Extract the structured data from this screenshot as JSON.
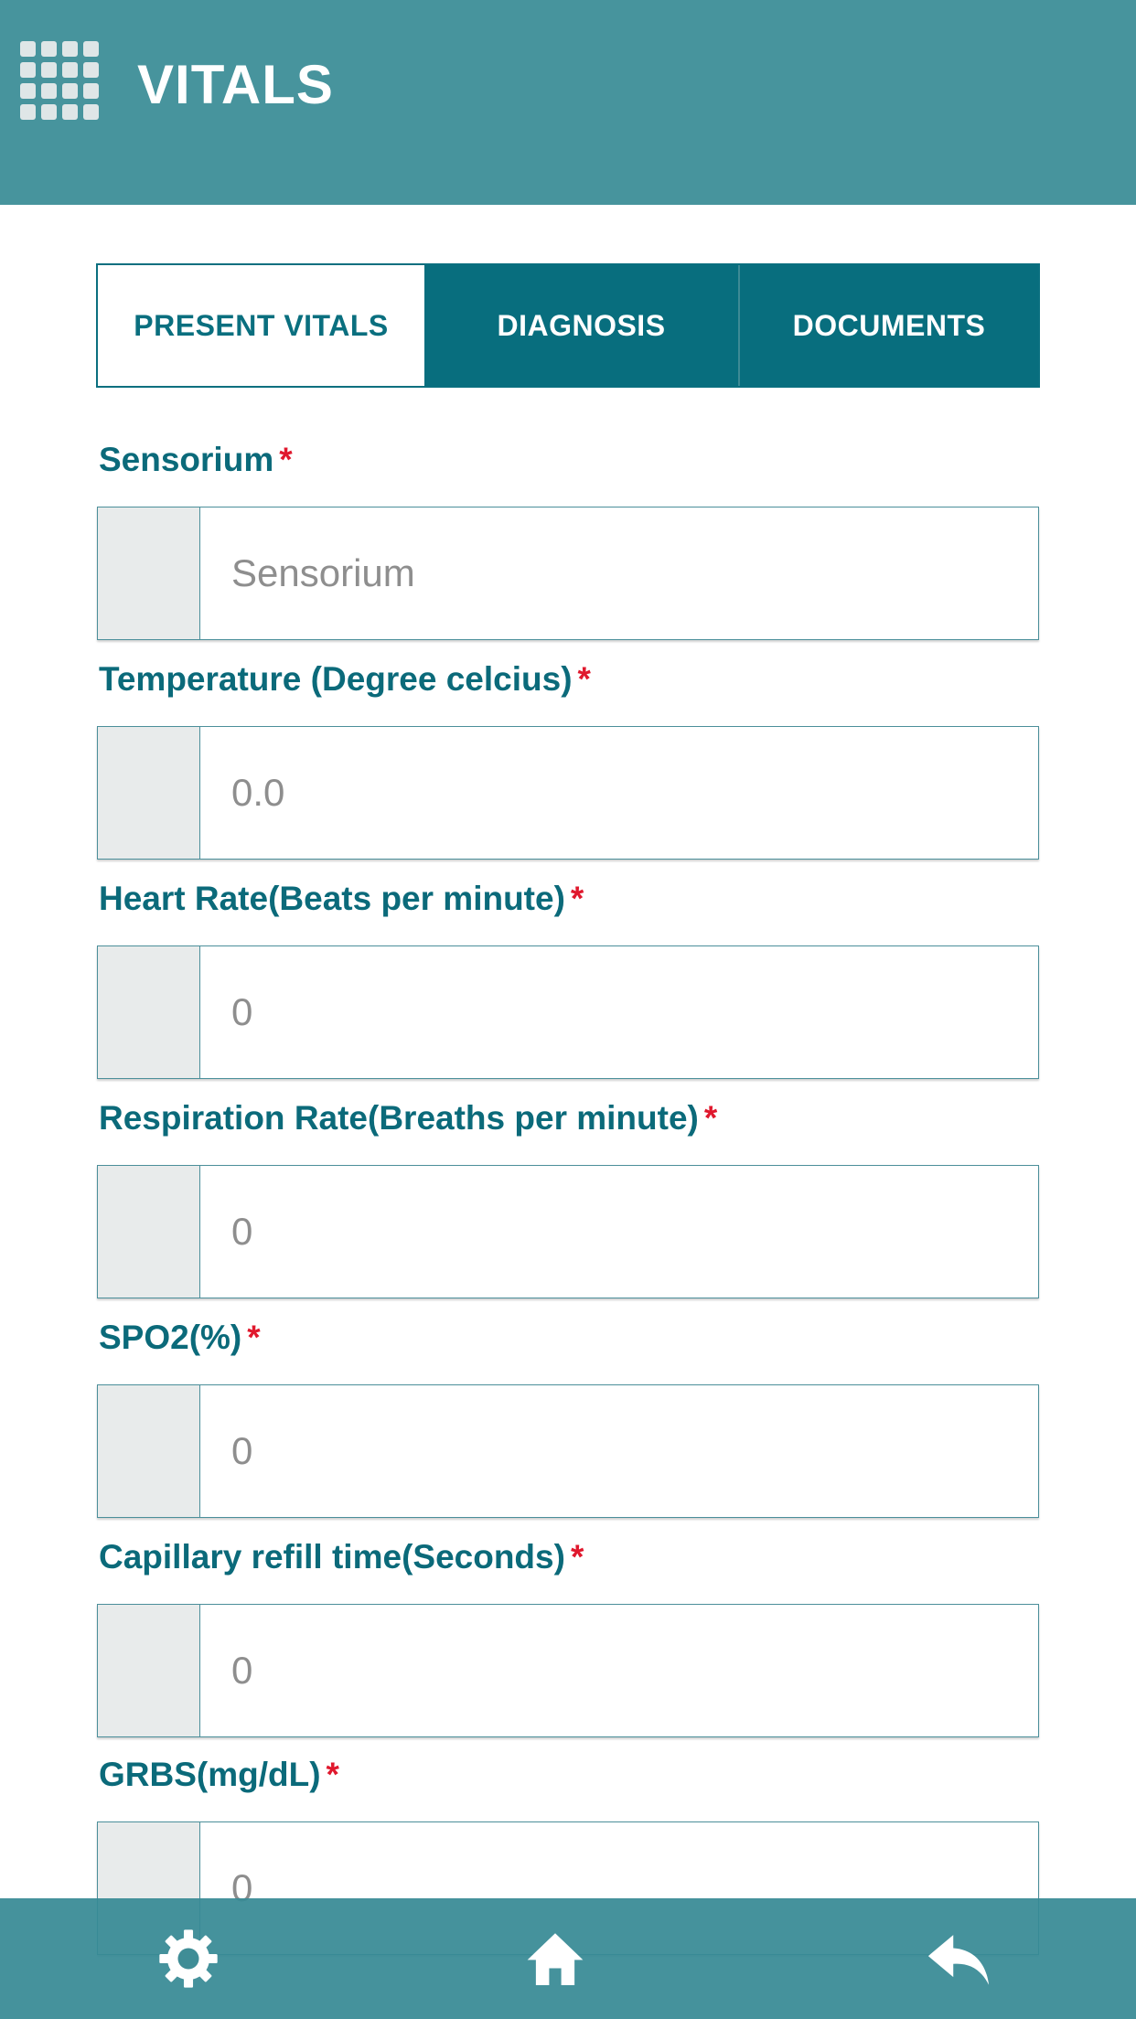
{
  "header": {
    "title": "VITALS",
    "menu_icon": "grid-menu-icon"
  },
  "tabs": [
    {
      "label": "PRESENT VITALS",
      "active": true
    },
    {
      "label": "DIAGNOSIS",
      "active": false
    },
    {
      "label": "DOCUMENTS",
      "active": false
    }
  ],
  "fields": [
    {
      "label": "Sensorium",
      "required": "*",
      "placeholder": "Sensorium"
    },
    {
      "label": "Temperature (Degree celcius)",
      "required": "*",
      "placeholder": "0.0"
    },
    {
      "label": "Heart Rate(Beats per minute)",
      "required": "*",
      "placeholder": "0"
    },
    {
      "label": "Respiration Rate(Breaths per minute)",
      "required": "*",
      "placeholder": "0"
    },
    {
      "label": "SPO2(%)",
      "required": "*",
      "placeholder": "0"
    },
    {
      "label": "Capillary refill time(Seconds)",
      "required": "*",
      "placeholder": "0"
    },
    {
      "label": "GRBS(mg/dL)",
      "required": "*",
      "placeholder": "0"
    }
  ],
  "footer": {
    "icons": [
      "settings-icon",
      "home-icon",
      "back-icon"
    ]
  },
  "colors": {
    "header_bg": "#47949d",
    "tab_active_text": "#0a6f7f",
    "tab_inactive_bg": "#086e7e",
    "label_text": "#0b6a7a",
    "required_mark": "#e0182d",
    "footer_bg": "#378a94"
  }
}
